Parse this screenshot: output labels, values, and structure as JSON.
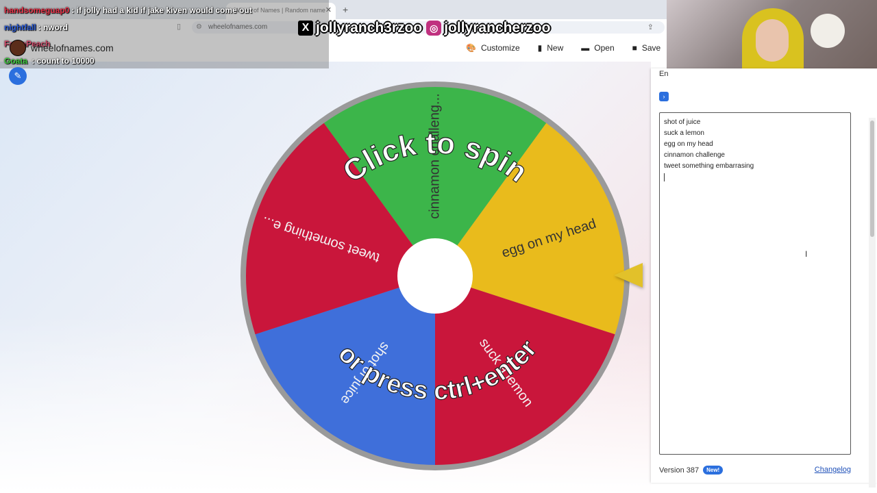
{
  "browser": {
    "tab_title": "Wheel of Names | Random name",
    "url": "wheelofnames.com"
  },
  "chat": {
    "messages": [
      {
        "user": "handsomeguap0",
        "user_color": "#e8334a",
        "text": ": if jolly had a kid if jake kiven would come out"
      },
      {
        "user": "nightfall",
        "user_color": "#2a5bd6",
        "text": ": nword"
      },
      {
        "user": "FantaPeach",
        "user_color": "#d44f6e",
        "text": ""
      },
      {
        "user": "Goata",
        "user_color": "#3ecb3e",
        "text": " : count to 10000"
      }
    ],
    "site_title": "wheelofnames.com"
  },
  "social": {
    "twitter": "jollyranch3rzoo",
    "instagram": "jollyrancherzoo"
  },
  "toolbar": {
    "customize": "Customize",
    "new": "New",
    "open": "Open",
    "save": "Save"
  },
  "wheel": {
    "segments": [
      {
        "label": "cinnamon challeng...",
        "color": "#3cb54a"
      },
      {
        "label": "egg on my head",
        "color": "#e9bb1c"
      },
      {
        "label": "suck a lemon",
        "color": "#c9163b"
      },
      {
        "label": "shot of juice",
        "color": "#3f6fda"
      },
      {
        "label": "tweet something e...",
        "color": "#c9163b"
      }
    ],
    "prompt_top": "Click to spin",
    "prompt_bottom": "or press ctrl+enter",
    "pointer_color": "#e2c12a"
  },
  "panel": {
    "tab_label": "En",
    "entries": [
      "shot of juice",
      "suck a lemon",
      "egg on my head",
      "cinnamon challenge",
      "tweet something embarrasing"
    ],
    "version": "Version 387",
    "new_badge": "New!",
    "changelog": "Changelog"
  }
}
